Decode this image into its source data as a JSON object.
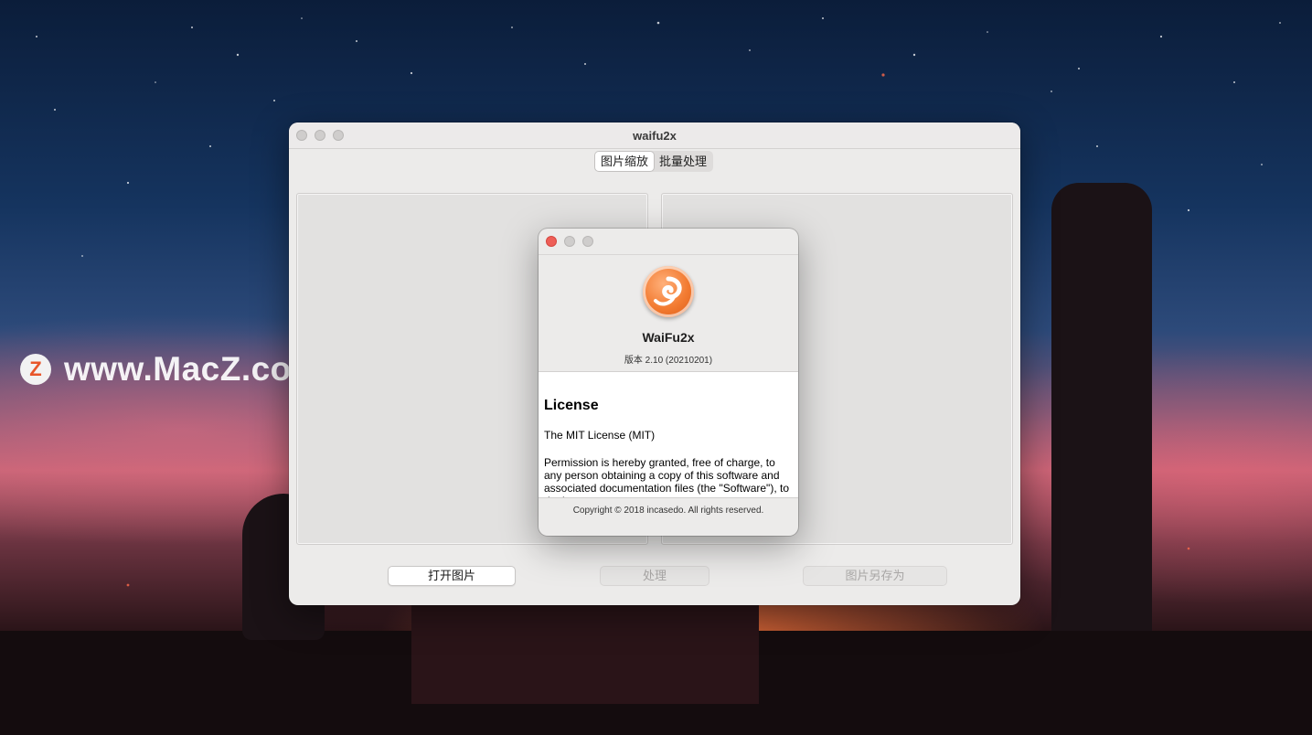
{
  "watermark": {
    "logo_letter": "Z",
    "text": "www.MacZ.com"
  },
  "main_window": {
    "title": "waifu2x",
    "tabs": [
      {
        "label": "图片缩放",
        "selected": true
      },
      {
        "label": "批量处理",
        "selected": false
      }
    ],
    "buttons": {
      "open": {
        "label": "打开图片",
        "enabled": true
      },
      "process": {
        "label": "处理",
        "enabled": false
      },
      "save_as": {
        "label": "图片另存为",
        "enabled": false
      }
    }
  },
  "about_dialog": {
    "app_name": "WaiFu2x",
    "version": "版本 2.10 (20210201)",
    "license_heading": "License",
    "license_lines": [
      "The MIT License (MIT)",
      "Permission is hereby granted, free of charge, to any person obtaining a copy of this software and associated documentation files (the \"Software\"), to deal"
    ],
    "copyright": "Copyright © 2018 incasedo. All rights reserved."
  },
  "colors": {
    "close_red": "#ee5e57",
    "app_icon_orange": "#f27a30"
  },
  "icons": {
    "app_icon": "waifu2x-swirl-icon",
    "watermark_logo": "macz-logo-icon"
  }
}
